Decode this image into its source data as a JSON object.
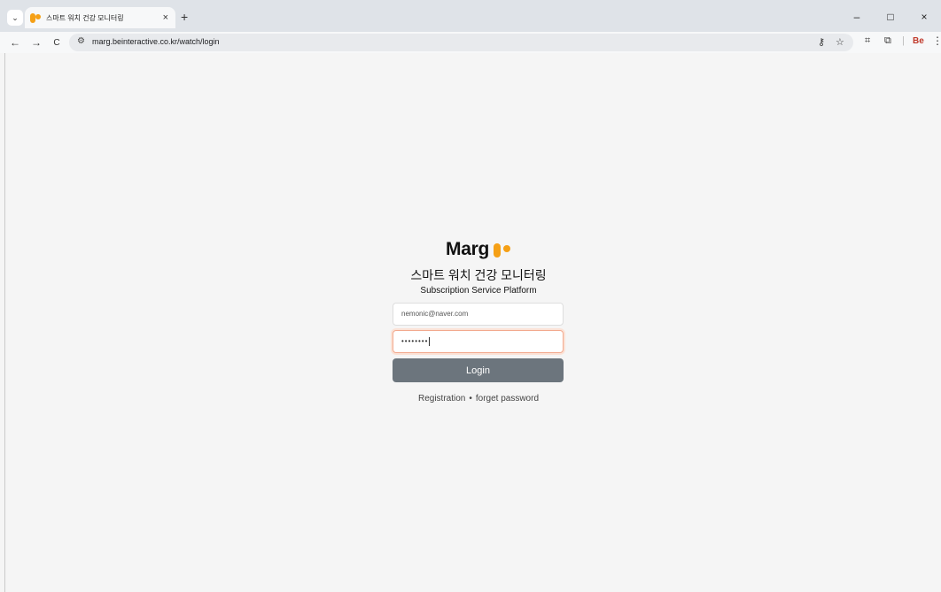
{
  "browser": {
    "tab": {
      "title": "스마트 워치 건강 모니터링",
      "close_glyph": "×"
    },
    "new_tab_glyph": "+",
    "tab_search_glyph": "⌄",
    "window_controls": {
      "minimize": "–",
      "maximize": "□",
      "close": "×"
    },
    "nav": {
      "back": "←",
      "forward": "→",
      "reload": "C"
    },
    "address_bar": {
      "url": "marg.beinteractive.co.kr/watch/login"
    },
    "toolbar_icons": [
      "password-key-icon",
      "bookmark-star-icon",
      "tab-screenshot-icon",
      "extensions-icon",
      "behance-extension-icon",
      "menu-icon"
    ],
    "extension_label": "Be",
    "menu_glyph": "⋮"
  },
  "page": {
    "brand": {
      "name": "Marg",
      "accent_color": "#f5a016"
    },
    "title_ko": "스마트 워치 건강 모니터링",
    "subtitle_en": "Subscription Service Platform",
    "email_field": {
      "value": "nemonic@naver.com"
    },
    "password_field": {
      "masked_value": "••••••••"
    },
    "login_button": {
      "label": "Login",
      "color": "#6c757d"
    },
    "links": {
      "registration": "Registration",
      "separator": "•",
      "forget_password": "forget password"
    }
  }
}
